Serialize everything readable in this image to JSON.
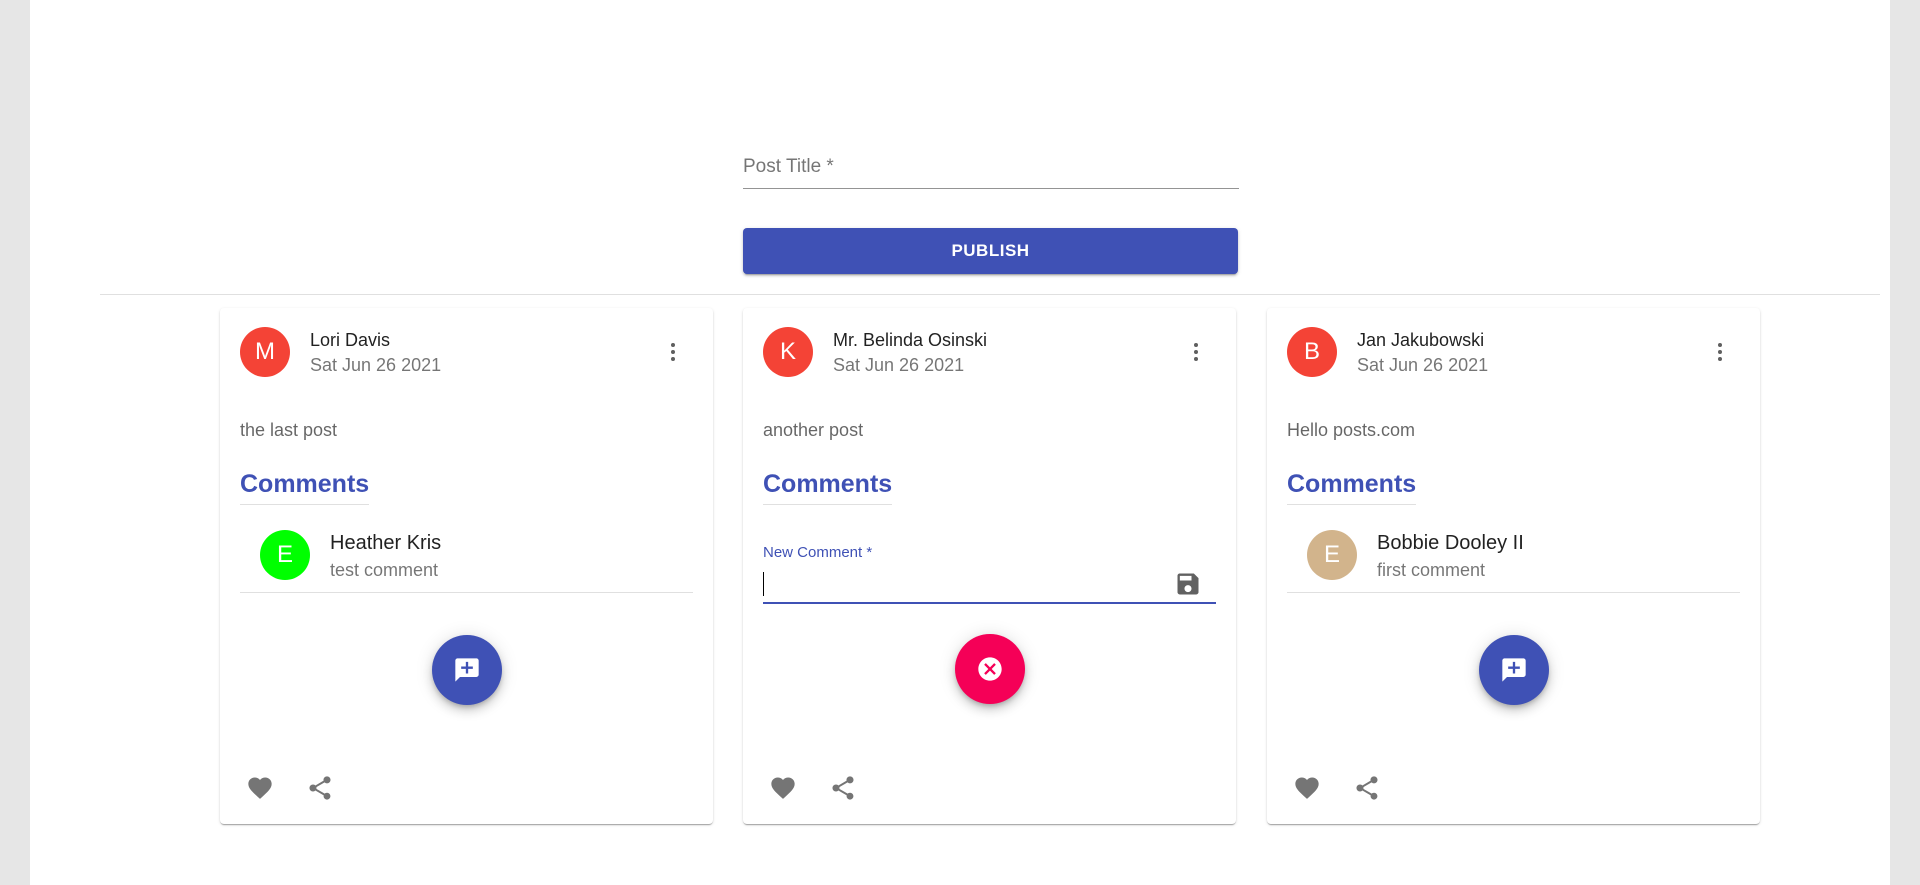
{
  "post_form": {
    "title_placeholder": "Post Title *",
    "title_value": "",
    "publish_label": "PUBLISH"
  },
  "colors": {
    "primary": "#3f51b5",
    "secondary": "#f50057",
    "avatar_red": "#f44336",
    "avatar_green": "#00ff00",
    "avatar_tan": "#d2b48c"
  },
  "posts": [
    {
      "avatar_letter": "M",
      "avatar_color": "#f44336",
      "author": "Lori Davis",
      "date": "Sat Jun 26 2021",
      "body": "the last post",
      "comments_heading": "Comments",
      "comment": {
        "avatar_letter": "E",
        "avatar_color": "#00ff00",
        "author": "Heather Kris",
        "text": "test comment"
      },
      "fab_icon": "add-comment-icon"
    },
    {
      "avatar_letter": "K",
      "avatar_color": "#f44336",
      "author": "Mr. Belinda Osinski",
      "date": "Sat Jun 26 2021",
      "body": "another post",
      "comments_heading": "Comments",
      "new_comment_label": "New Comment *",
      "new_comment_value": "",
      "fab_icon": "cancel-icon"
    },
    {
      "avatar_letter": "B",
      "avatar_color": "#f44336",
      "author": "Jan Jakubowski",
      "date": "Sat Jun 26 2021",
      "body": "Hello posts.com",
      "comments_heading": "Comments",
      "comment": {
        "avatar_letter": "E",
        "avatar_color": "#d2b48c",
        "author": "Bobbie Dooley II",
        "text": "first comment"
      },
      "fab_icon": "add-comment-icon"
    }
  ],
  "icons": {
    "more": "more-vert-icon",
    "like": "heart-icon",
    "share": "share-icon",
    "save": "save-icon"
  }
}
